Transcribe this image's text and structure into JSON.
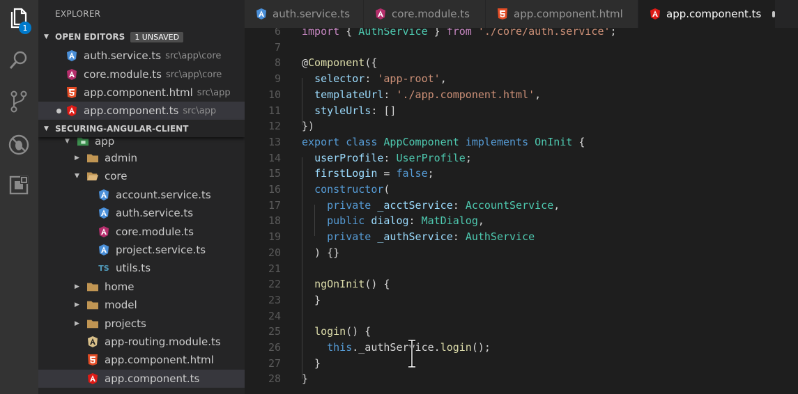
{
  "activity_bar": {
    "explorer_badge": "1",
    "icons": [
      "files-icon",
      "search-icon",
      "source-control-icon",
      "debug-icon",
      "extensions-icon"
    ]
  },
  "sidebar": {
    "title": "EXPLORER",
    "open_editors": {
      "label": "OPEN EDITORS",
      "badge": "1 UNSAVED",
      "items": [
        {
          "name": "auth.service.ts",
          "path": "src\\app\\core",
          "icon": "angular-service-icon"
        },
        {
          "name": "core.module.ts",
          "path": "src\\app\\core",
          "icon": "angular-icon"
        },
        {
          "name": "app.component.html",
          "path": "src\\app",
          "icon": "html5-icon"
        },
        {
          "name": "app.component.ts",
          "path": "src\\app",
          "icon": "angular-icon",
          "unsaved": true
        }
      ]
    },
    "project": {
      "label": "SECURING-ANGULAR-CLIENT",
      "tree": [
        {
          "name": "app",
          "icon": "app-folder-icon"
        },
        {
          "name": "admin",
          "icon": "folder-icon"
        },
        {
          "name": "core",
          "icon": "folder-open-icon"
        },
        {
          "name": "account.service.ts",
          "icon": "angular-service-icon"
        },
        {
          "name": "auth.service.ts",
          "icon": "angular-service-icon"
        },
        {
          "name": "core.module.ts",
          "icon": "angular-icon"
        },
        {
          "name": "project.service.ts",
          "icon": "angular-service-icon"
        },
        {
          "name": "utils.ts",
          "icon": "typescript-icon"
        },
        {
          "name": "home",
          "icon": "folder-icon"
        },
        {
          "name": "model",
          "icon": "folder-icon"
        },
        {
          "name": "projects",
          "icon": "folder-icon"
        },
        {
          "name": "app-routing.module.ts",
          "icon": "angular-routing-icon"
        },
        {
          "name": "app.component.html",
          "icon": "html5-icon"
        },
        {
          "name": "app.component.ts",
          "icon": "angular-icon"
        }
      ]
    }
  },
  "tabs": [
    {
      "label": "auth.service.ts",
      "icon": "angular-service-icon"
    },
    {
      "label": "core.module.ts",
      "icon": "angular-icon"
    },
    {
      "label": "app.component.html",
      "icon": "html5-icon"
    },
    {
      "label": "app.component.ts",
      "icon": "angular-icon",
      "active": true,
      "modified": true
    }
  ],
  "editor": {
    "line_numbers": [
      "6",
      "7",
      "8",
      "9",
      "10",
      "11",
      "12",
      "13",
      "14",
      "15",
      "16",
      "17",
      "18",
      "19",
      "20",
      "21",
      "22",
      "23",
      "24",
      "25",
      "26",
      "27",
      "28"
    ],
    "lines": [
      "import { AuthService } from './core/auth.service';",
      "",
      "@Component({",
      "  selector: 'app-root',",
      "  templateUrl: './app.component.html',",
      "  styleUrls: []",
      "})",
      "export class AppComponent implements OnInit {",
      "  userProfile: UserProfile;",
      "  firstLogin = false;",
      "  constructor(",
      "    private _acctService: AccountService,",
      "    public dialog: MatDialog,",
      "    private _authService: AuthService",
      "  ) {}",
      "",
      "  ngOnInit() {",
      "  }",
      "",
      "  login() {",
      "    this._authService.login();",
      "  }",
      "}"
    ]
  },
  "colors": {
    "keyword": "#569cd6",
    "control": "#c586c0",
    "string": "#ce9178",
    "type": "#4ec9b0",
    "function": "#dcdcaa",
    "variable": "#9cdcfe",
    "plain": "#d4d4d4"
  }
}
